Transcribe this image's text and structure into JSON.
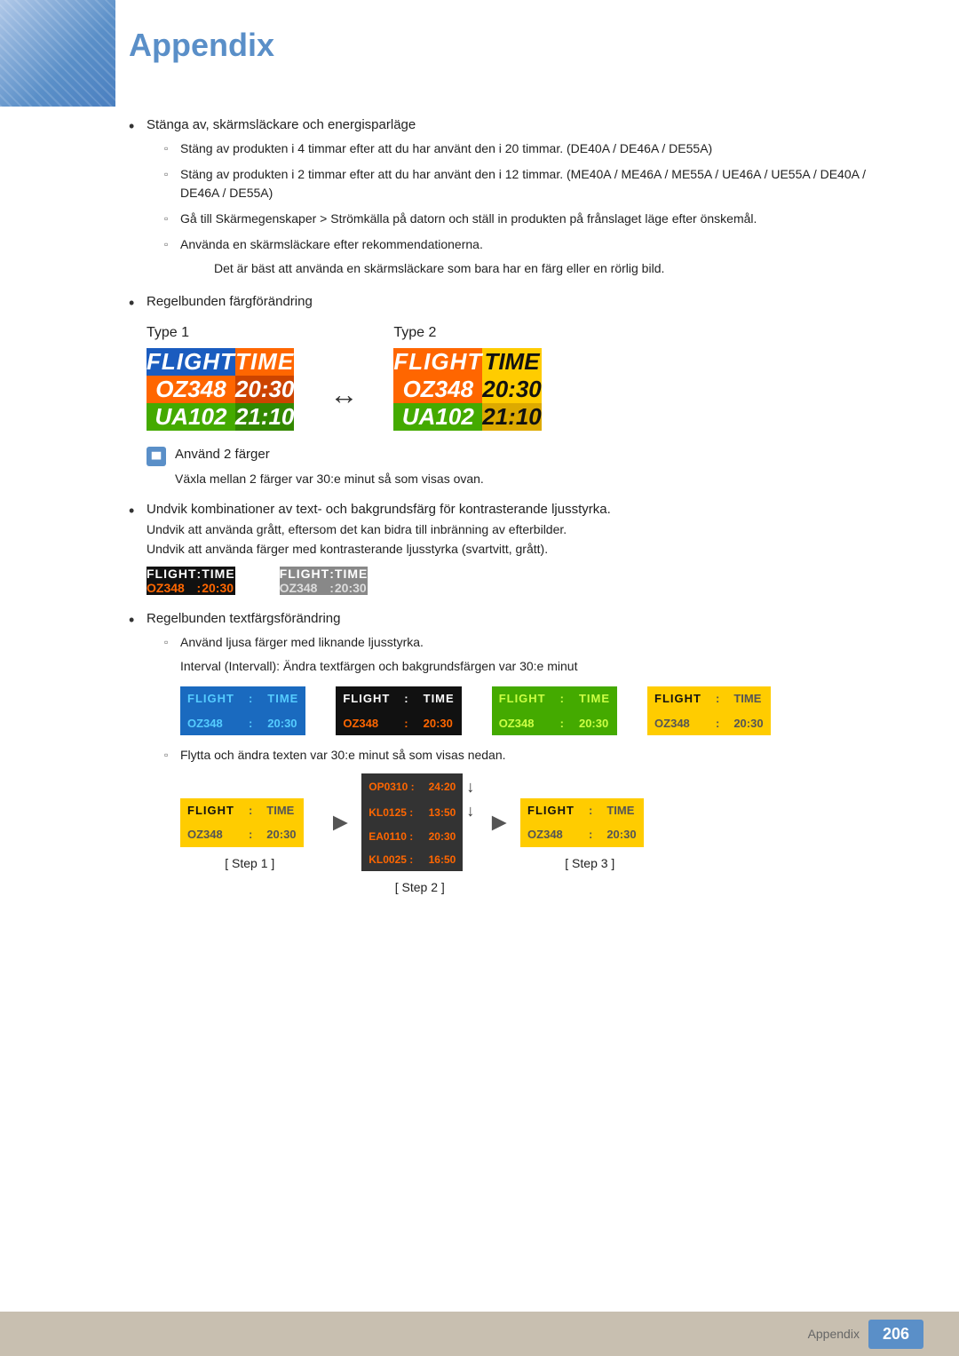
{
  "title": "Appendix",
  "page_number": "206",
  "footer_label": "Appendix",
  "bullet1": {
    "text": "Stänga av, skärmsläckare och energisparläge",
    "sub1": "Stäng av produkten i 4 timmar efter att du har använt den i 20 timmar. (DE40A / DE46A / DE55A)",
    "sub2": "Stäng av produkten i 2 timmar efter att du har använt den i 12 timmar. (ME40A / ME46A / ME55A / UE46A / UE55A / DE40A / DE46A / DE55A)",
    "sub3": "Gå till Skärmegenskaper > Strömkälla på datorn och ställ in produkten på frånslaget läge efter önskemål.",
    "sub4": "Använda en skärmsläckare efter rekommendationerna.",
    "indent_note": "Det är bäst att använda en skärmsläckare som bara har en färg eller en rörlig bild."
  },
  "bullet2": {
    "text": "Regelbunden färgförändring",
    "type1_label": "Type 1",
    "type2_label": "Type 2",
    "flight_label": "FLIGHT",
    "time_label": "TIME",
    "oz348": "OZ348",
    "time1": "20:30",
    "ua102": "UA102",
    "time2": "21:10",
    "note_text": "Använd 2 färger",
    "note_sub": "Växla mellan 2 färger var 30:e minut så som visas ovan."
  },
  "bullet3": {
    "text": "Undvik kombinationer av text- och bakgrundsfärg för kontrasterande ljusstyrka.",
    "line2": "Undvik att använda grått, eftersom det kan bidra till inbränning av efterbilder.",
    "line3": "Undvik att använda färger med kontrasterande ljusstyrka (svartvitt, grått).",
    "table1": {
      "row1": [
        "FLIGHT",
        ":",
        "TIME"
      ],
      "row2": [
        "OZ348",
        ":",
        "20:30"
      ]
    },
    "table2": {
      "row1": [
        "FLIGHT",
        ":",
        "TIME"
      ],
      "row2": [
        "OZ348",
        ":",
        "20:30"
      ]
    }
  },
  "bullet4": {
    "text": "Regelbunden textfärgsförändring",
    "sub1": "Använd ljusa färger med liknande ljusstyrka.",
    "interval_note": "Interval (Intervall): Ändra textfärgen och bakgrundsfärgen var 30:e minut",
    "tables": [
      {
        "row1": [
          "FLIGHT",
          ":",
          "TIME"
        ],
        "row2": [
          "OZ348",
          ":",
          "20:30"
        ]
      },
      {
        "row1": [
          "FLIGHT",
          ":",
          "TIME"
        ],
        "row2": [
          "OZ348",
          ":",
          "20:30"
        ]
      },
      {
        "row1": [
          "FLIGHT",
          ":",
          "TIME"
        ],
        "row2": [
          "OZ348",
          ":",
          "20:30"
        ]
      },
      {
        "row1": [
          "FLIGHT",
          ":",
          "TIME"
        ],
        "row2": [
          "OZ348",
          ":",
          "20:30"
        ]
      }
    ],
    "sub2": "Flytta och ändra texten var 30:e minut så som visas nedan.",
    "steps": {
      "step1_label": "[ Step 1 ]",
      "step2_label": "[ Step 2 ]",
      "step3_label": "[ Step 3 ]",
      "step2_data": [
        [
          "OP0310 :",
          "24:20"
        ],
        [
          "KL0125 :",
          "13:50"
        ],
        [
          "EA0110 :",
          "20:30"
        ],
        [
          "KL0025 :",
          "16:50"
        ]
      ]
    }
  }
}
